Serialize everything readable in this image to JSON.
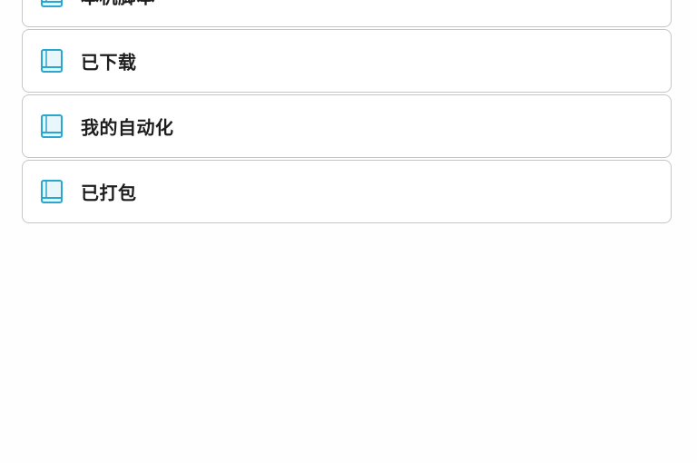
{
  "list": {
    "items": [
      {
        "label": "本机脚本",
        "icon": "book-icon"
      },
      {
        "label": "已下载",
        "icon": "book-icon"
      },
      {
        "label": "我的自动化",
        "icon": "book-icon"
      },
      {
        "label": "已打包",
        "icon": "book-icon"
      }
    ]
  },
  "colors": {
    "icon_stroke": "#2aa6cf",
    "icon_fill": "#e8f7fc",
    "border": "#c6c6c6",
    "text": "#1d1d1d",
    "background": "#fefefe"
  }
}
